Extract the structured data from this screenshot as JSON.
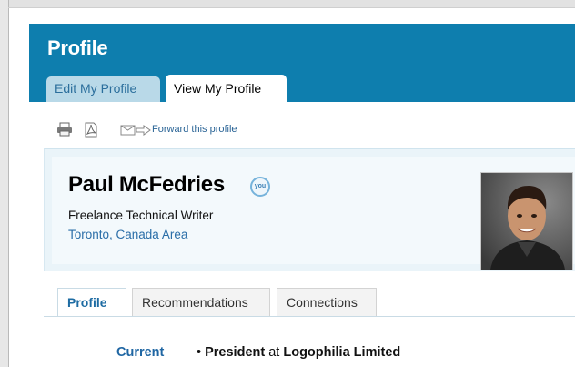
{
  "header": {
    "title": "Profile",
    "tabs": [
      {
        "label": "Edit My Profile"
      },
      {
        "label": "View My Profile"
      }
    ]
  },
  "toolbar": {
    "icons": [
      "printer-icon",
      "pdf-icon",
      "forward-icon"
    ],
    "forward_label": "Forward this profile"
  },
  "profile": {
    "name": "Paul McFedries",
    "badge": "you",
    "headline": "Freelance Technical Writer",
    "location": "Toronto, Canada Area"
  },
  "subtabs": [
    {
      "label": "Profile"
    },
    {
      "label": "Recommendations"
    },
    {
      "label": "Connections"
    }
  ],
  "current": {
    "label": "Current",
    "title": "President",
    "at": "at",
    "company": "Logophilia Limited"
  },
  "colors": {
    "header_bg": "#0e7eae",
    "link": "#2a6ea8"
  }
}
